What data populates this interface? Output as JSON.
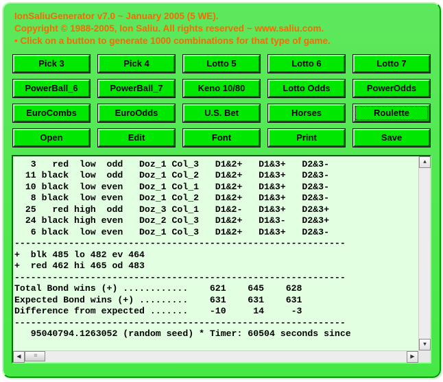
{
  "header": {
    "line1": "IonSaliuGenerator v7.0 ~ January 2005 (5 WE).",
    "line2": "Copyright © 1988-2005, Ion Saliu. All rights reserved ~ www.saliu.com.",
    "line3": "• Click on a button to generate 1000 combinations for that type of game."
  },
  "buttons": {
    "row1": [
      "Pick 3",
      "Pick 4",
      "Lotto 5",
      "Lotto 6",
      "Lotto 7"
    ],
    "row2": [
      "PowerBall_6",
      "PowerBall_7",
      "Keno 10/80",
      "Lotto Odds",
      "PowerOdds"
    ],
    "row3": [
      "EuroCombs",
      "EuroOdds",
      "U.S. Bet",
      "Horses",
      "Roulette"
    ],
    "row4": [
      "Open",
      "Edit",
      "Font",
      "Print",
      "Save"
    ]
  },
  "focused_button": "Roulette",
  "output_text": "   3   red  low  odd   Doz_1 Col_3   D1&2+   D1&3+   D2&3-\n  11 black  low  odd   Doz_1 Col_2   D1&2+   D1&3+   D2&3-\n  10 black  low even   Doz_1 Col_1   D1&2+   D1&3+   D2&3-\n   8 black  low even   Doz_1 Col_2   D1&2+   D1&3+   D2&3-\n  25   red high  odd   Doz_3 Col_1   D1&2-   D1&3+   D2&3+\n  24 black high even   Doz_2 Col_3   D1&2+   D1&3-   D2&3+\n   6 black  low even   Doz_1 Col_3   D1&2+   D1&3+   D2&3-\n-------------------------------------------------------------\n+  blk 485 lo 482 ev 464\n+  red 462 hi 465 od 483\n-------------------------------------------------------------\nTotal Bond wins (+) ............    621    645    628\nExpected Bond wins (+) .........    631    631    631\nDifference from expected .......    -10     14     -3\n-------------------------------------------------------------\n   95040794.1263052 (random seed) * Timer: 60504 seconds since"
}
